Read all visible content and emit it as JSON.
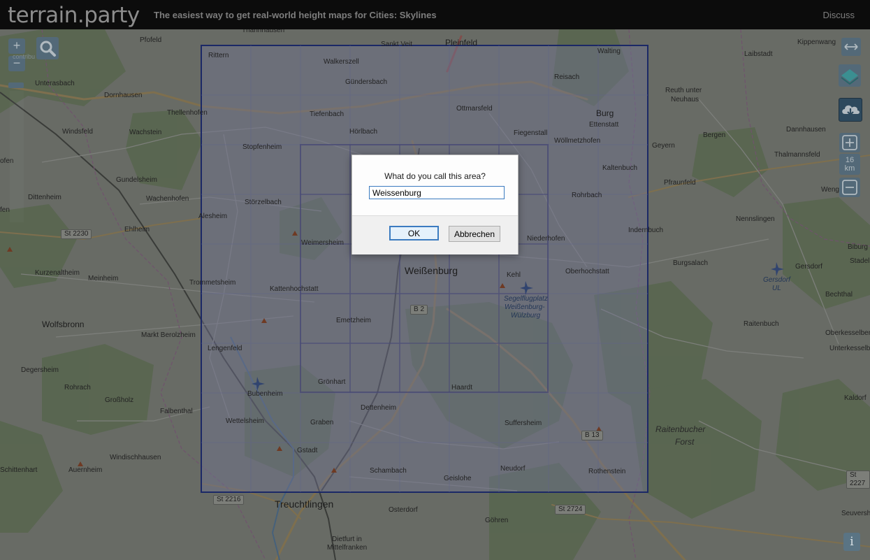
{
  "header": {
    "logo": "terrain.party",
    "tagline": "The easiest way to get real-world height maps for Cities: Skylines",
    "discuss": "Discuss"
  },
  "controls": {
    "zoom_in": "+",
    "zoom_out": "−",
    "size_increase": "+",
    "size_decrease": "−",
    "size_value": "16",
    "size_unit": "km",
    "info": "i",
    "contribution_fragment": "contribu"
  },
  "map": {
    "labels": [
      "Thannhausen",
      "Sankt Veit",
      "Pleinfeld",
      "Pfofeld",
      "Walting",
      "Laibstadt",
      "Kippenwang",
      "Rittern",
      "Walkerszell",
      "Reisach",
      "Unterasbach",
      "Gündersbach",
      "Dornhausen",
      "Thellenhofen",
      "Ottmarsfeld",
      "Reuth unter",
      "Neuhaus",
      "Tiefenbach",
      "Burg",
      "Windsfeld",
      "Wachstein",
      "Hörlbach",
      "Fiegenstall",
      "Ettenstatt",
      "Dannhausen",
      "Wöllmetzhofen",
      "Stopfenheim",
      "Geyern",
      "Bergen",
      "Thalmannsfeld",
      "Gundelsheim",
      "Kaltenbuch",
      "Dittenheim",
      "Wachenhofen",
      "Störzelbach",
      "Pfraunfeld",
      "Wengen",
      "Rohrbach",
      "Alesheim",
      "Ehlheim",
      "Indernbuch",
      "Nennslingen",
      "Niederhofen",
      "Weimersheim",
      "Biburg",
      "Weißenburg",
      "Kurzenaltheim",
      "Meinheim",
      "Burgsalach",
      "Stadeln",
      "Gersdorf",
      "Oberhochstatt",
      "Kehl",
      "Trommetsheim",
      "Kattenhochstatt",
      "Segelflugplatz",
      "Weißenburg-",
      "Wülzburg",
      "Bechthal",
      "Emetzheim",
      "Wolfsbronn",
      "Raitenbuch",
      "Markt Berolzheim",
      "Oberkesselberg",
      "Unterkesselberg",
      "Lengenfeld",
      "Degersheim",
      "Grönhart",
      "Haardt",
      "Bubenheim",
      "Rohrach",
      "Großholz",
      "Kaldorf",
      "Dettenheim",
      "Falbenthal",
      "Wettelsheim",
      "Graben",
      "Suffersheim",
      "Raitenbucher",
      "Forst",
      "Gstadt",
      "Windischhausen",
      "Auernheim",
      "Schambach",
      "Neudorf",
      "Schittenhart",
      "Geislohe",
      "Rothenstein",
      "Treuchtlingen",
      "Osterdorf",
      "Göhren",
      "Seuversholz",
      "Dietfurt in",
      "Mittelfranken",
      "Gersdorf",
      "UL",
      "ofen",
      "fen"
    ],
    "roads": [
      "St 2230",
      "B 2",
      "B 13",
      "St 2216",
      "St 2724",
      "St 2227"
    ]
  },
  "dialog": {
    "prompt": "What do you call this area?",
    "value": "Weissenburg",
    "ok": "OK",
    "cancel": "Abbrechen"
  },
  "colors": {
    "selection_border": "#1b2a70",
    "selection_fill": "#7e80a8",
    "header_bg": "#0a0a0a",
    "button_accent": "#3b7bc0"
  }
}
